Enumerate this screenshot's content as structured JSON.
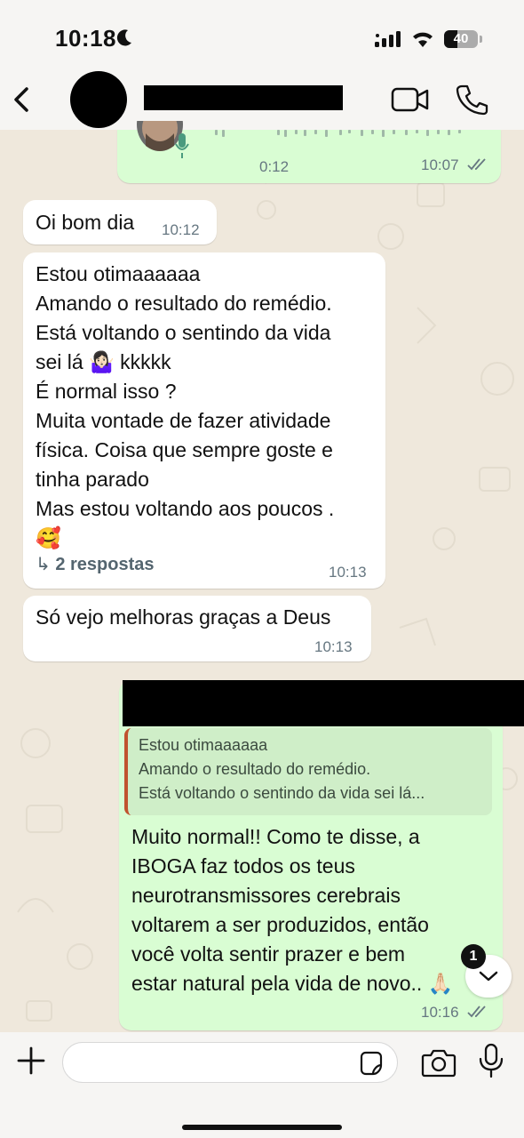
{
  "status_bar": {
    "time": "10:18",
    "battery": "40",
    "battery_level": 0.4
  },
  "header": {
    "contact_name": "",
    "icons": [
      "back-icon",
      "video-call-icon",
      "phone-call-icon"
    ]
  },
  "voice_message": {
    "duration": "0:12",
    "time": "10:07",
    "status": "read"
  },
  "messages": [
    {
      "direction": "in",
      "text": "Oi bom dia",
      "time": "10:12"
    },
    {
      "direction": "in",
      "text": "Estou otimaaaaaa\nAmando o resultado do remédio.\nEstá voltando o sentindo da vida\nsei lá 🤷🏻‍♀️ kkkkk\nÉ normal isso ?\nMuita vontade de fazer atividade\nfísica. Coisa que sempre goste e\ntinha parado\nMas estou voltando aos poucos .\n🥰",
      "replies": "2 respostas",
      "time": "10:13"
    },
    {
      "direction": "in",
      "text": "Só vejo melhoras graças a Deus",
      "time": "10:13"
    },
    {
      "direction": "out",
      "quoted": [
        "Estou otimaaaaaa",
        "Amando o resultado do remédio.",
        "Está voltando o sentindo da vida sei lá..."
      ],
      "text": "Muito normal!! Como te disse, a\nIBOGA faz todos os teus\nneurotransmissores cerebrais\nvoltarem a ser produzidos, então\nvocê volta sentir prazer e bem\nestar natural pela vida de novo.. 🙏🏻",
      "time": "10:16",
      "status": "read"
    }
  ],
  "scroll_down": {
    "unread_count": "1"
  },
  "composer": {
    "value": "",
    "placeholder": ""
  },
  "colors": {
    "incoming_bubble": "#ffffff",
    "outgoing_bubble": "#d9fdd3",
    "chat_background": "#efe8dc",
    "reply_accent": "#c0532e",
    "meta_text": "#667781"
  }
}
